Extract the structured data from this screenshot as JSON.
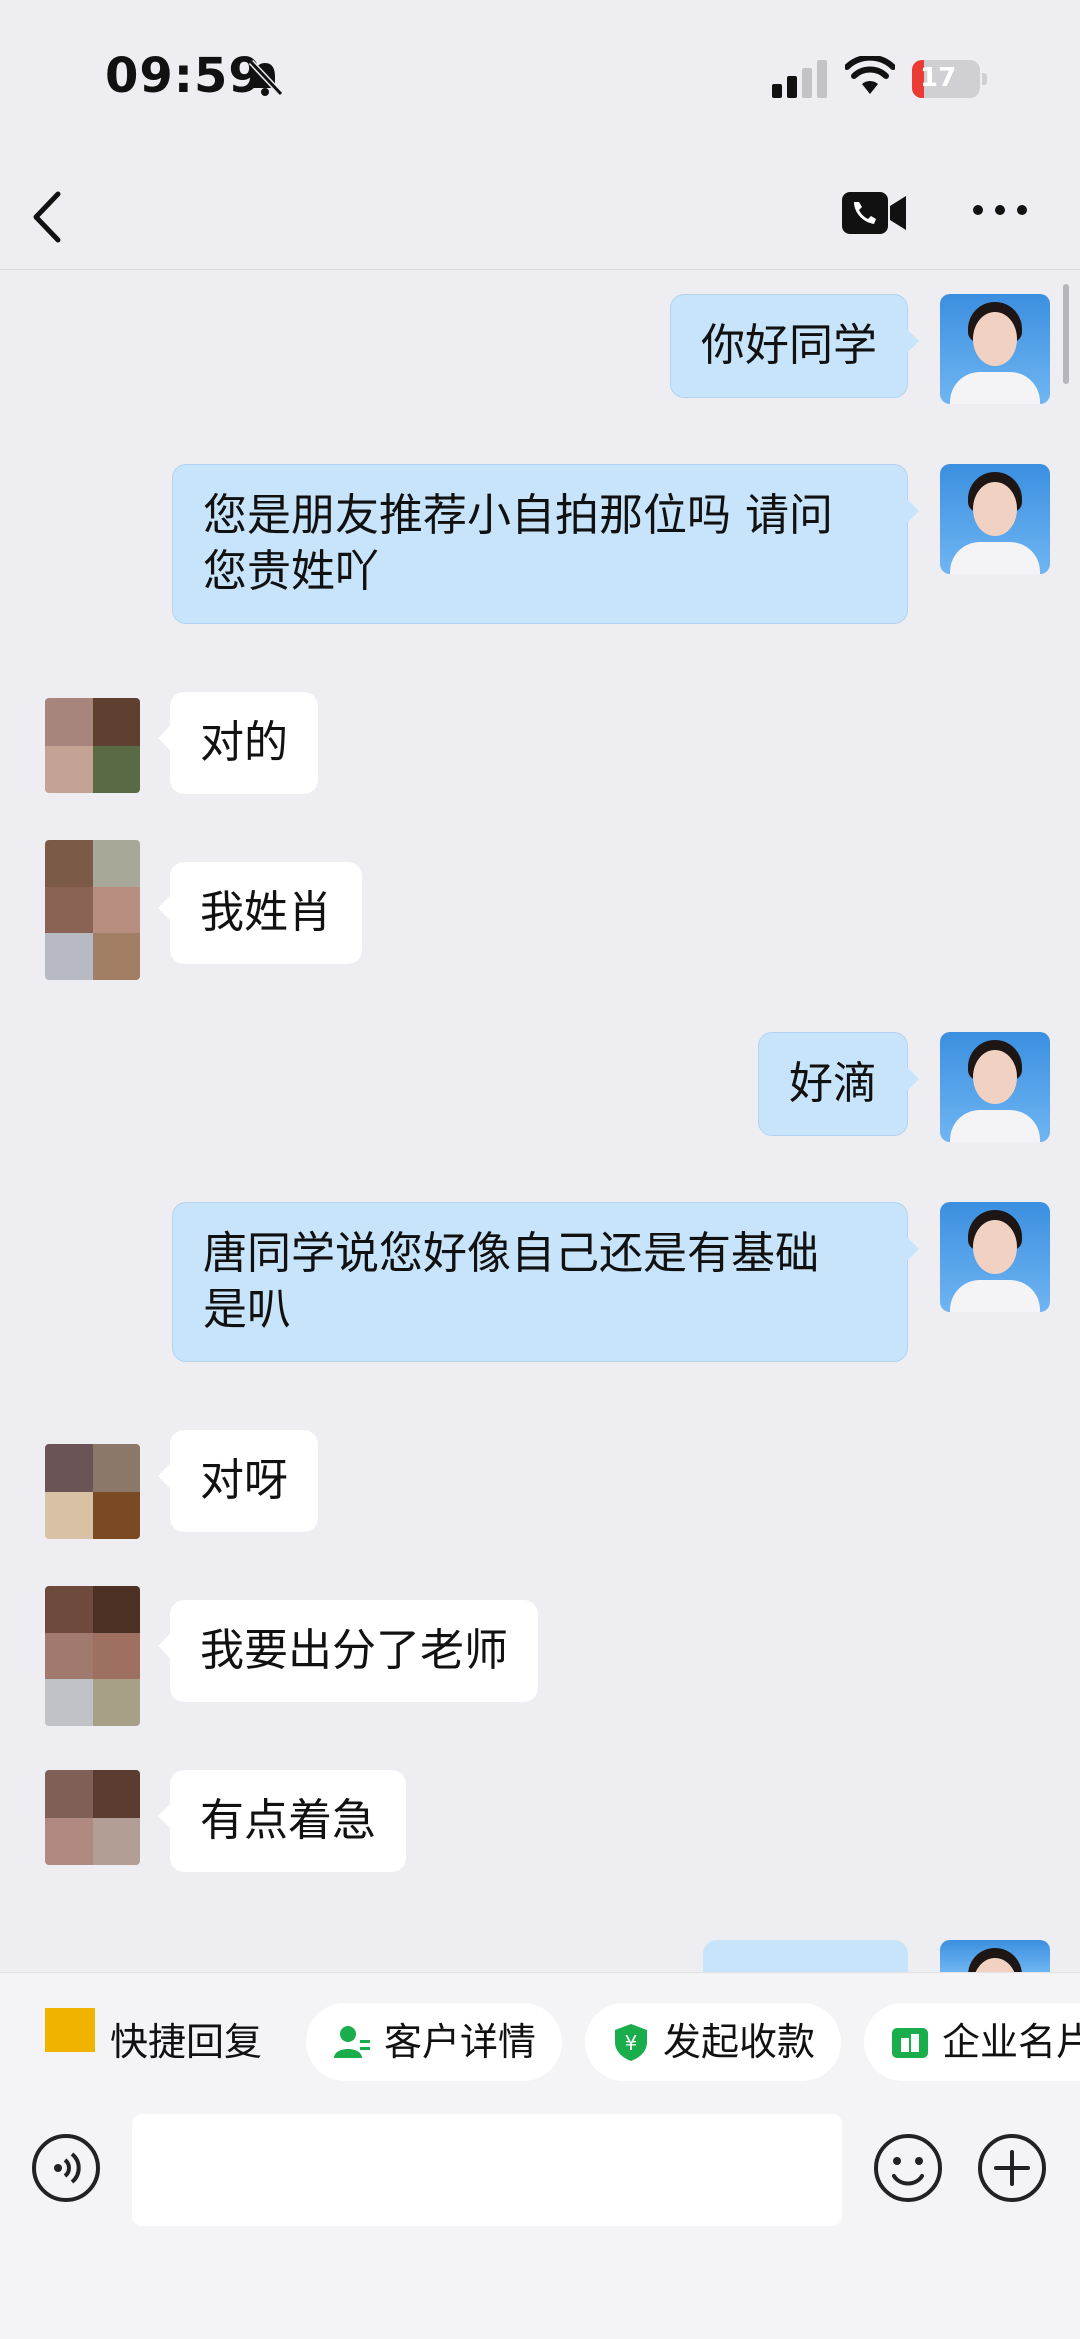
{
  "status_bar": {
    "time": "09:59",
    "battery_level": "17",
    "battery_fraction": 0.17,
    "icons": [
      "bell-slash-icon",
      "signal-icon",
      "wifi-icon",
      "battery-icon"
    ]
  },
  "nav": {
    "icons": [
      "back-icon",
      "video-call-icon",
      "more-icon"
    ]
  },
  "messages": [
    {
      "side": "out",
      "text": "你好同学"
    },
    {
      "side": "out",
      "text": "您是朋友推荐小自拍那位吗 请问\n您贵姓吖"
    },
    {
      "side": "in",
      "text": "对的"
    },
    {
      "side": "in",
      "text": "我姓肖"
    },
    {
      "side": "out",
      "text": "好滴"
    },
    {
      "side": "out",
      "text": "唐同学说您好像自己还是有基础\n是叭"
    },
    {
      "side": "in",
      "text": "对呀"
    },
    {
      "side": "in",
      "text": "我要出分了老师"
    },
    {
      "side": "in",
      "text": "有点着急"
    }
  ],
  "quick_actions": [
    {
      "label": "快捷回复",
      "icon": "quick-reply-icon"
    },
    {
      "label": "客户详情",
      "icon": "customer-icon",
      "color": "#1aad4b"
    },
    {
      "label": "发起收款",
      "icon": "payment-shield-icon",
      "color": "#1aad4b"
    },
    {
      "label": "企业名片",
      "icon": "business-card-icon",
      "color": "#1aad4b"
    }
  ],
  "input_bar": {
    "icons": [
      "voice-icon",
      "emoji-icon",
      "plus-icon"
    ]
  },
  "colors": {
    "background": "#ededf2",
    "outgoing_bubble": "#c8e4fb",
    "incoming_bubble": "#ffffff",
    "accent_green": "#1aad4b",
    "battery_red": "#ea3b34"
  }
}
